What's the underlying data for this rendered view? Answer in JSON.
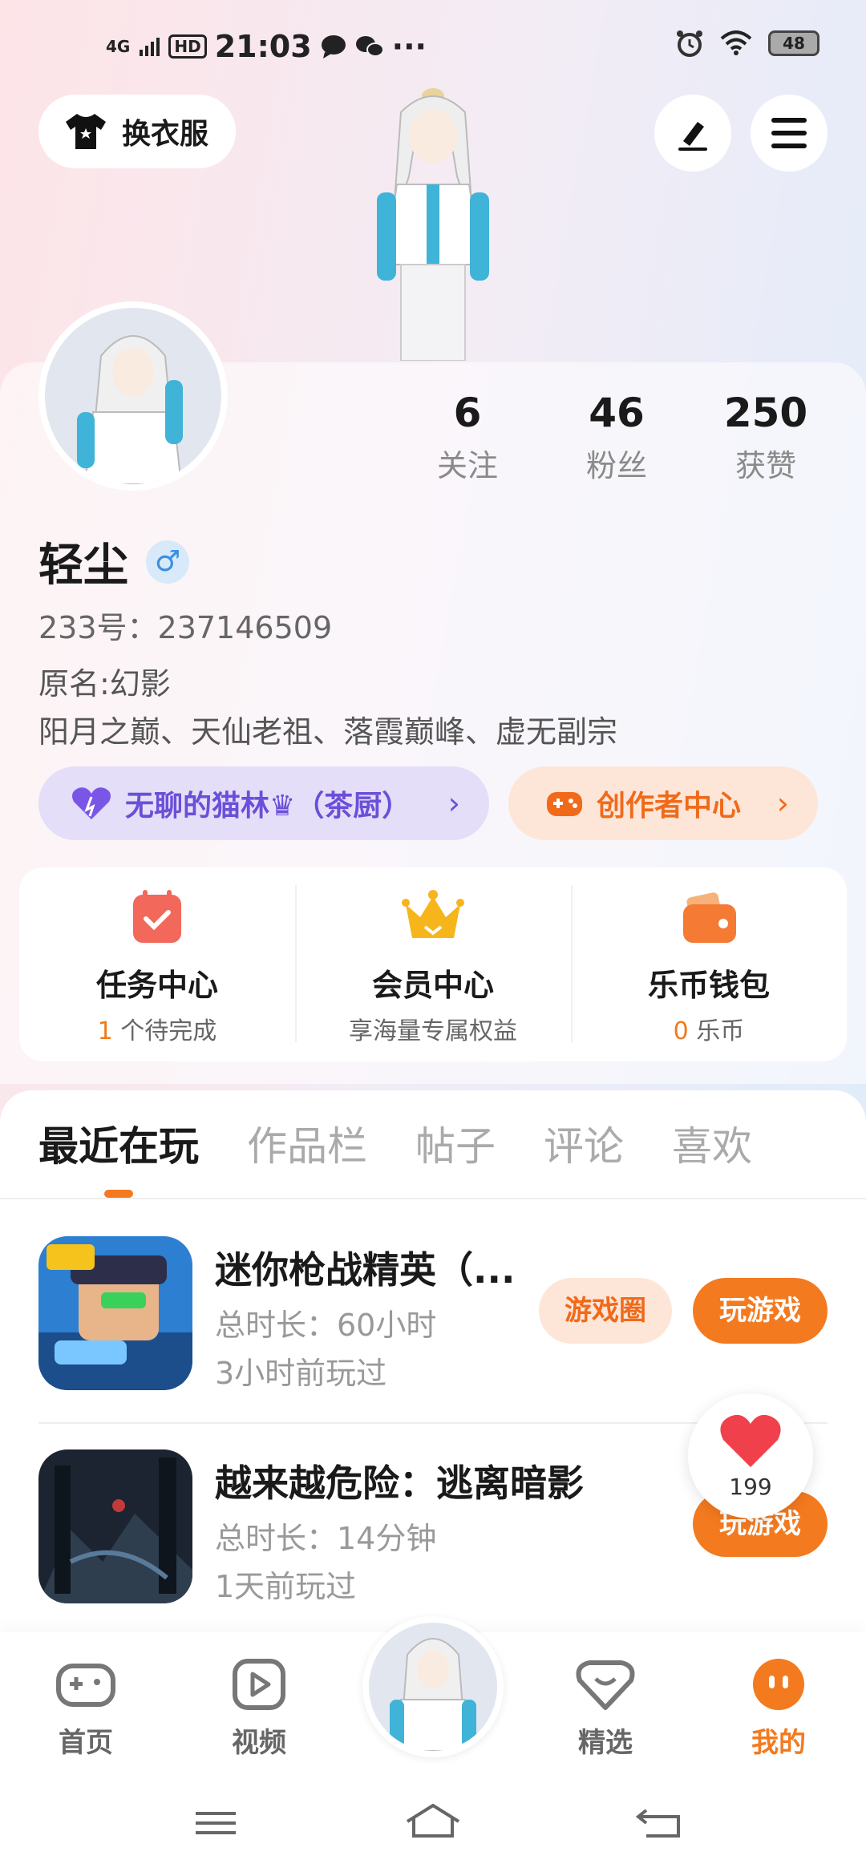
{
  "status_bar": {
    "network": "4G",
    "hd": "HD",
    "time": "21:03",
    "extra": "···",
    "battery": "48"
  },
  "header": {
    "dress_label": "换衣服"
  },
  "profile": {
    "stats": [
      {
        "value": "6",
        "label": "关注"
      },
      {
        "value": "46",
        "label": "粉丝"
      },
      {
        "value": "250",
        "label": "获赞"
      }
    ],
    "username": "轻尘",
    "gender_symbol": "♂",
    "uid": "233号：237146509",
    "bio_line1": "原名:幻影",
    "bio_line2": "阳月之巅、天仙老祖、落霞巅峰、虚无副宗",
    "guild_label": "无聊的猫林♛（茶厨）",
    "creator_label": "创作者中心"
  },
  "quick": [
    {
      "title": "任务中心",
      "num": "1",
      "sub": " 个待完成"
    },
    {
      "title": "会员中心",
      "num": "",
      "sub": "享海量专属权益"
    },
    {
      "title": "乐币钱包",
      "num": "0",
      "sub": " 乐币"
    }
  ],
  "tabs": [
    "最近在玩",
    "作品栏",
    "帖子",
    "评论",
    "喜欢"
  ],
  "games": [
    {
      "title": "迷你枪战精英（...",
      "duration": "总时长：60小时",
      "last_played": "3小时前玩过",
      "circle_label": "游戏圈",
      "play_label": "玩游戏"
    },
    {
      "title": "越来越危险：逃离暗影",
      "duration": "总时长：14分钟",
      "last_played": "1天前玩过",
      "play_label": "玩游戏"
    }
  ],
  "like_count": "199",
  "nav": {
    "home": "首页",
    "video": "视频",
    "picks": "精选",
    "mine": "我的"
  },
  "colors": {
    "accent": "#f47a1f",
    "guild": "#6b4fd8",
    "gender": "#3b8fe0"
  }
}
